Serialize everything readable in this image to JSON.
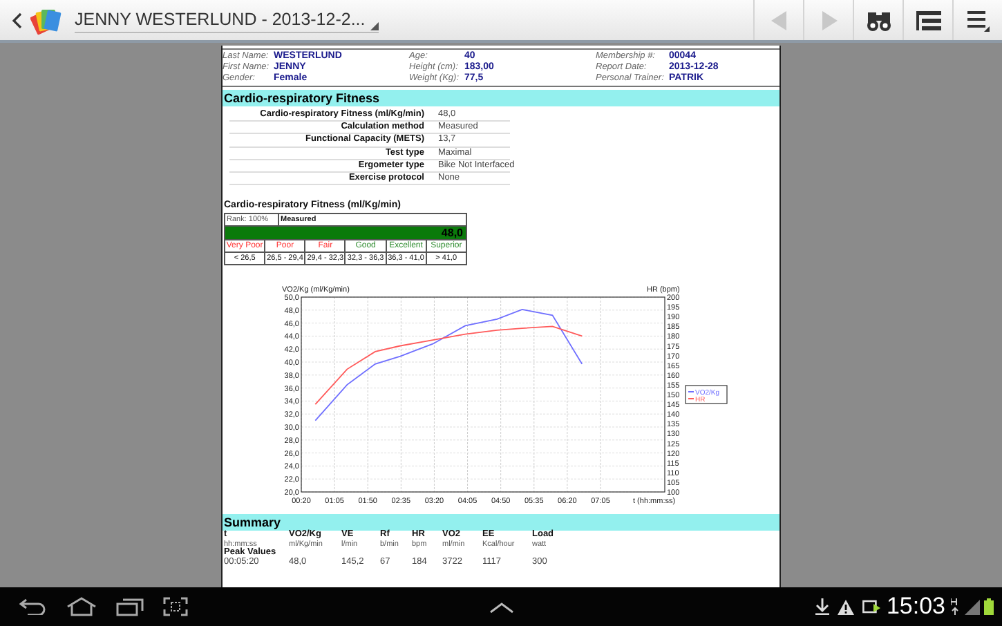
{
  "app_bar": {
    "title": "JENNY WESTERLUND - 2013-12-2...",
    "actions": [
      {
        "kind": "prev",
        "disabled": true
      },
      {
        "kind": "next",
        "disabled": true
      },
      {
        "kind": "find",
        "disabled": false
      },
      {
        "kind": "list",
        "disabled": false
      },
      {
        "kind": "menu",
        "disabled": false
      }
    ]
  },
  "report": {
    "info": [
      {
        "label": "Last Name:",
        "value": "WESTERLUND"
      },
      {
        "label": "Age:",
        "value": "40"
      },
      {
        "label": "Membership #:",
        "value": "00044"
      },
      {
        "label": "First Name:",
        "value": "JENNY"
      },
      {
        "label": "Height (cm):",
        "value": "183,00"
      },
      {
        "label": "Report Date:",
        "value": "2013-12-28"
      },
      {
        "label": "Gender:",
        "value": "Female"
      },
      {
        "label": "Weight (Kg):",
        "value": "77,5"
      },
      {
        "label": "Personal Trainer:",
        "value": "PATRIK"
      }
    ],
    "fitness": {
      "title": "Cardio-respiratory Fitness",
      "rows": [
        {
          "label": "Cardio-respiratory Fitness (ml/Kg/min)",
          "value": "48,0"
        },
        {
          "label": "Calculation method",
          "value": "Measured"
        },
        {
          "label": "Functional Capacity (METS)",
          "value": "13,7"
        },
        {
          "label": "Test type",
          "value": "Maximal"
        },
        {
          "label": "Ergometer type",
          "value": "Bike Not Interfaced"
        },
        {
          "label": "Exercise protocol",
          "value": "None"
        }
      ]
    },
    "rating": {
      "title": "Cardio-respiratory Fitness (ml/Kg/min)",
      "rank": "Rank: 100%",
      "method": "Measured",
      "score": "48,0",
      "level": 1,
      "classes": [
        {
          "name": "Very Poor",
          "range": "< 26,5",
          "color": "#ff3333"
        },
        {
          "name": "Poor",
          "range": "26,5 - 29,4",
          "color": "#ff3333"
        },
        {
          "name": "Fair",
          "range": "29,4 - 32,3",
          "color": "#ff3333"
        },
        {
          "name": "Good",
          "range": "32,3 - 36,3",
          "color": "#2e8b2e"
        },
        {
          "name": "Excellent",
          "range": "36,3 - 41,0",
          "color": "#2e8b2e"
        },
        {
          "name": "Superior",
          "range": "> 41,0",
          "color": "#2e8b2e"
        }
      ]
    },
    "chart_data": {
      "type": "line",
      "grid": true,
      "legend": "right",
      "xlabel": "t (hh:mm:ss)",
      "ylabel": "VO2/Kg (ml/Kg/min)",
      "y2label": "HR (bpm)",
      "x": [
        39,
        82,
        120,
        154,
        198,
        242,
        285,
        319,
        360,
        400
      ],
      "series": [
        {
          "name": "VO2/Kg",
          "color": "#6f6fff",
          "values": [
            31.0,
            36.5,
            39.7,
            40.9,
            42.8,
            45.6,
            46.6,
            48.1,
            47.2,
            39.7
          ]
        },
        {
          "name": "HR",
          "color": "#ff5a5a",
          "axis": "y2",
          "values": [
            145,
            163,
            172,
            175,
            178,
            181,
            183,
            184,
            185,
            180
          ]
        }
      ],
      "xlim": [
        20,
        512
      ],
      "ylim": [
        20,
        50
      ],
      "y2lim": [
        100,
        200
      ],
      "xticks": [
        {
          "value": 20,
          "label": "00:20"
        },
        {
          "value": 65,
          "label": "01:05"
        },
        {
          "value": 110,
          "label": "01:50"
        },
        {
          "value": 155,
          "label": "02:35"
        },
        {
          "value": 200,
          "label": "03:20"
        },
        {
          "value": 245,
          "label": "04:05"
        },
        {
          "value": 290,
          "label": "04:50"
        },
        {
          "value": 335,
          "label": "05:35"
        },
        {
          "value": 380,
          "label": "06:20"
        },
        {
          "value": 425,
          "label": "07:05"
        }
      ],
      "yticks": [
        {
          "value": 20,
          "label": "20,0"
        },
        {
          "value": 22,
          "label": "22,0"
        },
        {
          "value": 24,
          "label": "24,0"
        },
        {
          "value": 26,
          "label": "26,0"
        },
        {
          "value": 28,
          "label": "28,0"
        },
        {
          "value": 30,
          "label": "30,0"
        },
        {
          "value": 32,
          "label": "32,0"
        },
        {
          "value": 34,
          "label": "34,0"
        },
        {
          "value": 36,
          "label": "36,0"
        },
        {
          "value": 38,
          "label": "38,0"
        },
        {
          "value": 40,
          "label": "40,0"
        },
        {
          "value": 42,
          "label": "42,0"
        },
        {
          "value": 44,
          "label": "44,0"
        },
        {
          "value": 46,
          "label": "46,0"
        },
        {
          "value": 48,
          "label": "48,0"
        },
        {
          "value": 50,
          "label": "50,0"
        }
      ],
      "y2ticks": [
        100,
        105,
        110,
        115,
        120,
        125,
        130,
        135,
        140,
        145,
        150,
        155,
        160,
        165,
        170,
        175,
        180,
        185,
        190,
        195,
        200
      ]
    },
    "summary": {
      "title": "Summary",
      "columns": [
        {
          "name": "t",
          "unit": "hh:mm:ss"
        },
        {
          "name": "VO2/Kg",
          "unit": "ml/Kg/min"
        },
        {
          "name": "VE",
          "unit": "l/min"
        },
        {
          "name": "Rf",
          "unit": "b/min"
        },
        {
          "name": "HR",
          "unit": "bpm"
        },
        {
          "name": "VO2",
          "unit": "ml/min"
        },
        {
          "name": "EE",
          "unit": "Kcal/hour"
        },
        {
          "name": "Load",
          "unit": "watt"
        }
      ],
      "group": "Peak Values",
      "row": [
        "00:05:20",
        "48,0",
        "145,2",
        "67",
        "184",
        "3722",
        "1117",
        "300"
      ]
    }
  },
  "status_bar": {
    "time": "15:03"
  }
}
